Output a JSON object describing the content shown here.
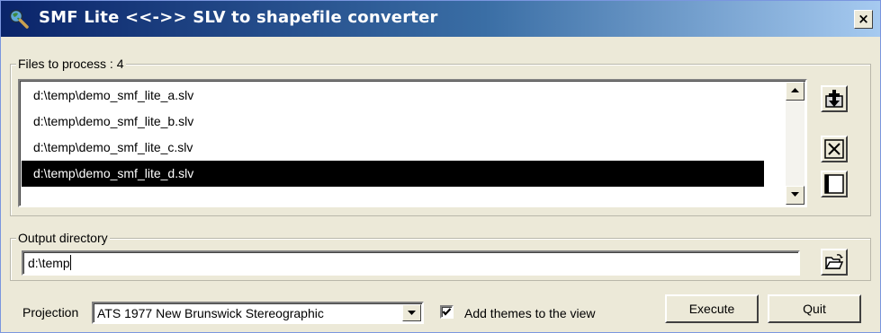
{
  "window": {
    "title": "SMF Lite <<->> SLV to shapefile converter",
    "close_glyph": "×",
    "icon": "magnifier-globe-icon"
  },
  "files_group": {
    "label": "Files to process : 4",
    "items": [
      {
        "label": "d:\\temp\\demo_smf_lite_a.slv",
        "selected": false
      },
      {
        "label": "d:\\temp\\demo_smf_lite_b.slv",
        "selected": false
      },
      {
        "label": "d:\\temp\\demo_smf_lite_c.slv",
        "selected": false
      },
      {
        "label": "d:\\temp\\demo_smf_lite_d.slv",
        "selected": true
      }
    ],
    "buttons": [
      "add-file-icon",
      "remove-file-icon",
      "clear-list-icon"
    ]
  },
  "output_group": {
    "label": "Output directory",
    "value": "d:\\temp",
    "browse_icon": "open-folder-icon"
  },
  "bottom": {
    "projection_label": "Projection",
    "projection_value": "ATS 1977 New Brunswick Stereographic",
    "add_themes_label": "Add themes to the view",
    "add_themes_checked": true,
    "execute_label": "Execute",
    "quit_label": "Quit"
  },
  "colors": {
    "title_gradient_start": "#0a246a",
    "title_gradient_end": "#a6caf0",
    "selection": "#000000",
    "face": "#ece9d8"
  }
}
